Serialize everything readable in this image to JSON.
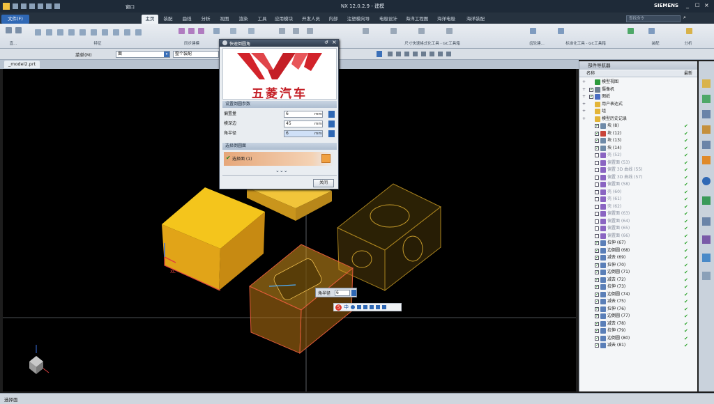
{
  "app": {
    "title": "NX 12.0.2.9 - 建模",
    "brand": "SIEMENS",
    "window_menu": "窗口"
  },
  "tabs": [
    "文件(F)",
    "主页",
    "装配",
    "曲线",
    "分析",
    "视图",
    "渲染",
    "工具",
    "应用模块",
    "开发人员",
    "内部",
    "注塑模向导",
    "电极设计",
    "海洋工程图",
    "海洋电极",
    "海洋装配"
  ],
  "search": {
    "placeholder": "查找命令"
  },
  "ribbon_groups": [
    "直...",
    "特征",
    "同步建模",
    "尺寸快速格式化工具 - GC工具箱",
    "齿轮建...",
    "标准化工具 - GC工具箱",
    "装配",
    "分析"
  ],
  "selection_bar": {
    "menu_label": "菜单(M)",
    "filter_value": "面",
    "scope_value": "整个装配"
  },
  "document_tab": "_model2.prt",
  "dialog": {
    "title": "快速倒圆角",
    "logo_text": "五菱汽车",
    "params_section": "设置倒圆参数",
    "fields": [
      {
        "label": "偏置量",
        "value": "6",
        "unit": "mm"
      },
      {
        "label": "模深边",
        "value": "45",
        "unit": "mm"
      },
      {
        "label": "角半径",
        "value": "6",
        "unit": "mm"
      }
    ],
    "select_section": "选择倒圆面",
    "selected": "选择面 (1)",
    "close_button": "关闭"
  },
  "viewport": {
    "label_xc": "XC",
    "onscreen_label": "角半径",
    "onscreen_value": "6",
    "ime_label": "中"
  },
  "nav": {
    "title": "部件导航器",
    "col_name": "名称",
    "col_latest": "最新",
    "rows": [
      {
        "label": "模型视图",
        "dim": false,
        "chk": false,
        "ok": false,
        "color": "#2b9a3a"
      },
      {
        "label": "摄像机",
        "dim": false,
        "chk": true,
        "ok": false,
        "color": "#6e7f90"
      },
      {
        "label": "图纸",
        "dim": false,
        "chk": true,
        "ok": false,
        "color": "#4a6ec2"
      },
      {
        "label": "用户表达式",
        "dim": false,
        "chk": false,
        "ok": false,
        "color": "#e3b437"
      },
      {
        "label": "组",
        "dim": false,
        "chk": false,
        "ok": false,
        "color": "#e3b437"
      },
      {
        "label": "模型历史记录",
        "dim": false,
        "chk": false,
        "ok": false,
        "color": "#e3b437"
      },
      {
        "label": "块 (8)",
        "dim": false,
        "chk": true,
        "ok": true,
        "color": "#6e8aa8"
      },
      {
        "label": "块 (12)",
        "dim": false,
        "chk": true,
        "ok": true,
        "color": "#c8443a"
      },
      {
        "label": "块 (13)",
        "dim": false,
        "chk": true,
        "ok": true,
        "color": "#6e8aa8"
      },
      {
        "label": "块 (14)",
        "dim": false,
        "chk": true,
        "ok": true,
        "color": "#6e8aa8"
      },
      {
        "label": "壳 (52)",
        "dim": true,
        "chk": false,
        "ok": true,
        "color": "#8a64c2"
      },
      {
        "label": "偏置面 (53)",
        "dim": true,
        "chk": false,
        "ok": true,
        "color": "#8a64c2"
      },
      {
        "label": "偏置 3D 曲线 (55)",
        "dim": true,
        "chk": false,
        "ok": true,
        "color": "#8a64c2"
      },
      {
        "label": "偏置 3D 曲线 (57)",
        "dim": true,
        "chk": false,
        "ok": true,
        "color": "#8a64c2"
      },
      {
        "label": "偏置面 (58)",
        "dim": true,
        "chk": false,
        "ok": true,
        "color": "#8a64c2"
      },
      {
        "label": "壳 (60)",
        "dim": true,
        "chk": false,
        "ok": true,
        "color": "#8a64c2"
      },
      {
        "label": "壳 (61)",
        "dim": true,
        "chk": false,
        "ok": true,
        "color": "#8a64c2"
      },
      {
        "label": "壳 (62)",
        "dim": true,
        "chk": false,
        "ok": true,
        "color": "#8a64c2"
      },
      {
        "label": "偏置面 (63)",
        "dim": true,
        "chk": false,
        "ok": true,
        "color": "#8a64c2"
      },
      {
        "label": "偏置面 (64)",
        "dim": true,
        "chk": false,
        "ok": true,
        "color": "#8a64c2"
      },
      {
        "label": "偏置面 (65)",
        "dim": true,
        "chk": false,
        "ok": true,
        "color": "#8a64c2"
      },
      {
        "label": "偏置面 (66)",
        "dim": true,
        "chk": false,
        "ok": true,
        "color": "#8a64c2"
      },
      {
        "label": "拉伸 (67)",
        "dim": false,
        "chk": true,
        "ok": true,
        "color": "#5a7fb8"
      },
      {
        "label": "边倒圆 (68)",
        "dim": false,
        "chk": true,
        "ok": true,
        "color": "#5a7fb8"
      },
      {
        "label": "减去 (69)",
        "dim": false,
        "chk": true,
        "ok": true,
        "color": "#5a7fb8"
      },
      {
        "label": "拉伸 (70)",
        "dim": false,
        "chk": true,
        "ok": true,
        "color": "#5a7fb8"
      },
      {
        "label": "边倒圆 (71)",
        "dim": false,
        "chk": true,
        "ok": true,
        "color": "#5a7fb8"
      },
      {
        "label": "减去 (72)",
        "dim": false,
        "chk": true,
        "ok": true,
        "color": "#5a7fb8"
      },
      {
        "label": "拉伸 (73)",
        "dim": false,
        "chk": true,
        "ok": true,
        "color": "#5a7fb8"
      },
      {
        "label": "边倒圆 (74)",
        "dim": false,
        "chk": true,
        "ok": true,
        "color": "#5a7fb8"
      },
      {
        "label": "减去 (75)",
        "dim": false,
        "chk": true,
        "ok": true,
        "color": "#5a7fb8"
      },
      {
        "label": "拉伸 (76)",
        "dim": false,
        "chk": true,
        "ok": true,
        "color": "#5a7fb8"
      },
      {
        "label": "边倒圆 (77)",
        "dim": false,
        "chk": true,
        "ok": true,
        "color": "#5a7fb8"
      },
      {
        "label": "减去 (78)",
        "dim": false,
        "chk": true,
        "ok": true,
        "color": "#5a7fb8"
      },
      {
        "label": "拉伸 (79)",
        "dim": false,
        "chk": true,
        "ok": true,
        "color": "#5a7fb8"
      },
      {
        "label": "边倒圆 (80)",
        "dim": false,
        "chk": true,
        "ok": true,
        "color": "#5a7fb8"
      },
      {
        "label": "减去 (81)",
        "dim": false,
        "chk": true,
        "ok": true,
        "color": "#5a7fb8"
      }
    ]
  },
  "status": {
    "text": "选择面"
  },
  "colors": {
    "accent": "#2f68b5",
    "cube_yellow": "#f0c020",
    "cube_amber": "#d9a020",
    "selected_red": "#e04040"
  }
}
